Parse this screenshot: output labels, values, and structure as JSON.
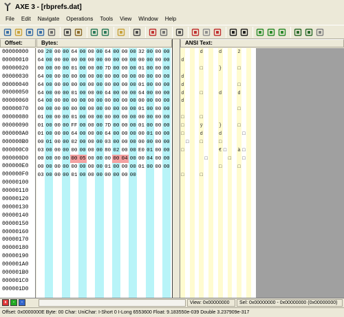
{
  "window": {
    "title": "AXE 3 - [rbprefs.dat]"
  },
  "menu": [
    "File",
    "Edit",
    "Navigate",
    "Operations",
    "Tools",
    "View",
    "Window",
    "Help"
  ],
  "toolbar": {
    "groups": [
      [
        "new-file-icon",
        "open-file-icon",
        "save-icon",
        "save-all-icon",
        "copy-icon"
      ],
      [
        "print-icon",
        "edit-icon"
      ],
      [
        "calculator-icon",
        "grid-icon"
      ],
      [
        "key-icon"
      ],
      [
        "goto-icon"
      ],
      [
        "bookmark-red-icon",
        "bookmark-gray-icon"
      ],
      [
        "split-icon"
      ],
      [
        "mark-red-icon",
        "mark-clear-icon",
        "mark-red2-icon"
      ],
      [
        "prev-icon",
        "next-icon"
      ],
      [
        "expand-icon",
        "collapse-icon",
        "zoom-icon"
      ],
      [
        "undo-icon",
        "redo-icon",
        "back-icon"
      ]
    ]
  },
  "headers": {
    "offset": "Offset:",
    "bytes": "Bytes:",
    "ansi": "ANSI Text:"
  },
  "offsets": [
    "00000000",
    "00000010",
    "00000020",
    "00000030",
    "00000040",
    "00000050",
    "00000060",
    "00000070",
    "00000080",
    "00000090",
    "000000A0",
    "000000B0",
    "000000C0",
    "000000D0",
    "000000E0",
    "000000F0",
    "00000100",
    "00000110",
    "00000120",
    "00000130",
    "00000140",
    "00000150",
    "00000160",
    "00000170",
    "00000180",
    "00000190",
    "000001A0",
    "000001B0",
    "000001C0",
    "000001D0"
  ],
  "bytes": [
    [
      "00",
      "20",
      "00",
      "00",
      "64",
      "00",
      "00",
      "00",
      "64",
      "00",
      "00",
      "00",
      "32",
      "00",
      "00",
      "00"
    ],
    [
      "64",
      "00",
      "00",
      "00",
      "00",
      "00",
      "00",
      "00",
      "00",
      "00",
      "00",
      "00",
      "00",
      "00",
      "00",
      "00"
    ],
    [
      "00",
      "00",
      "00",
      "00",
      "01",
      "00",
      "00",
      "00",
      "7D",
      "00",
      "00",
      "00",
      "01",
      "00",
      "00",
      "00"
    ],
    [
      "64",
      "00",
      "00",
      "00",
      "00",
      "00",
      "00",
      "00",
      "00",
      "00",
      "00",
      "00",
      "00",
      "00",
      "00",
      "00"
    ],
    [
      "64",
      "00",
      "00",
      "00",
      "00",
      "00",
      "00",
      "00",
      "00",
      "00",
      "00",
      "00",
      "01",
      "00",
      "00",
      "00"
    ],
    [
      "64",
      "00",
      "00",
      "00",
      "01",
      "00",
      "00",
      "00",
      "64",
      "00",
      "00",
      "00",
      "64",
      "00",
      "00",
      "00"
    ],
    [
      "64",
      "00",
      "00",
      "00",
      "00",
      "00",
      "00",
      "00",
      "00",
      "00",
      "00",
      "00",
      "00",
      "00",
      "00",
      "00"
    ],
    [
      "00",
      "00",
      "00",
      "00",
      "00",
      "00",
      "00",
      "00",
      "00",
      "00",
      "00",
      "00",
      "01",
      "00",
      "00",
      "00"
    ],
    [
      "01",
      "00",
      "00",
      "00",
      "01",
      "00",
      "00",
      "00",
      "00",
      "00",
      "00",
      "00",
      "00",
      "00",
      "00",
      "00"
    ],
    [
      "01",
      "00",
      "00",
      "00",
      "FF",
      "00",
      "00",
      "00",
      "7D",
      "00",
      "00",
      "00",
      "01",
      "00",
      "00",
      "00"
    ],
    [
      "01",
      "00",
      "00",
      "00",
      "64",
      "00",
      "00",
      "00",
      "64",
      "00",
      "00",
      "00",
      "00",
      "01",
      "00",
      "00"
    ],
    [
      "00",
      "01",
      "00",
      "00",
      "02",
      "00",
      "00",
      "00",
      "03",
      "00",
      "00",
      "00",
      "00",
      "00",
      "00",
      "00"
    ],
    [
      "03",
      "00",
      "00",
      "00",
      "00",
      "00",
      "00",
      "00",
      "80",
      "02",
      "00",
      "00",
      "E0",
      "01",
      "00",
      "00"
    ],
    [
      "00",
      "00",
      "00",
      "00",
      "00",
      "05",
      "00",
      "00",
      "00",
      "00",
      "04",
      "00",
      "00",
      "04",
      "00",
      "00"
    ],
    [
      "00",
      "00",
      "00",
      "00",
      "00",
      "00",
      "00",
      "00",
      "01",
      "00",
      "00",
      "00",
      "01",
      "00",
      "00",
      "00"
    ],
    [
      "03",
      "00",
      "00",
      "00",
      "01",
      "00",
      "00",
      "00",
      "00",
      "00",
      "00",
      "00"
    ]
  ],
  "highlight": [
    {
      "row": 13,
      "cols": [
        4,
        5,
        9,
        10
      ]
    }
  ],
  "ansi": [
    [
      "",
      "",
      "",
      "",
      "d",
      "",
      "",
      "",
      "d",
      "",
      "",
      "",
      "2",
      "",
      "",
      ""
    ],
    [
      "d",
      "",
      "",
      "",
      "",
      "",
      "",
      "",
      "",
      "",
      "",
      "",
      "",
      "",
      "",
      ""
    ],
    [
      "",
      "",
      "",
      "",
      "□",
      "",
      "",
      "",
      "}",
      "",
      "",
      "",
      "□",
      "",
      "",
      ""
    ],
    [
      "d",
      "",
      "",
      "",
      "",
      "",
      "",
      "",
      "",
      "",
      "",
      "",
      "",
      "",
      "",
      ""
    ],
    [
      "d",
      "",
      "",
      "",
      "",
      "",
      "",
      "",
      "",
      "",
      "",
      "",
      "□",
      "",
      "",
      ""
    ],
    [
      "d",
      "",
      "",
      "",
      "□",
      "",
      "",
      "",
      "d",
      "",
      "",
      "",
      "d",
      "",
      "",
      ""
    ],
    [
      "d",
      "",
      "",
      "",
      "",
      "",
      "",
      "",
      "",
      "",
      "",
      "",
      "",
      "",
      "",
      ""
    ],
    [
      "",
      "",
      "",
      "",
      "",
      "",
      "",
      "",
      "",
      "",
      "",
      "",
      "□",
      "",
      "",
      ""
    ],
    [
      "□",
      "",
      "",
      "",
      "□",
      "",
      "",
      "",
      "",
      "",
      "",
      "",
      "",
      "",
      "",
      ""
    ],
    [
      "□",
      "",
      "",
      "",
      "ÿ",
      "",
      "",
      "",
      "}",
      "",
      "",
      "",
      "□",
      "",
      "",
      ""
    ],
    [
      "□",
      "",
      "",
      "",
      "d",
      "",
      "",
      "",
      "d",
      "",
      "",
      "",
      "",
      "□",
      "",
      ""
    ],
    [
      "",
      "□",
      "",
      "",
      "□",
      "",
      "",
      "",
      "□",
      "",
      "",
      "",
      "",
      "",
      "",
      ""
    ],
    [
      "□",
      "",
      "",
      "",
      "",
      "",
      "",
      "",
      "€",
      "□",
      "",
      "",
      "à",
      "□",
      "",
      ""
    ],
    [
      "",
      "",
      "",
      "",
      "",
      "□",
      "",
      "",
      "",
      "",
      "□",
      "",
      "",
      "□",
      "",
      ""
    ],
    [
      "",
      "",
      "",
      "",
      "",
      "",
      "",
      "",
      "□",
      "",
      "",
      "",
      "□",
      "",
      "",
      ""
    ],
    [
      "□",
      "",
      "",
      "",
      "□",
      "",
      "",
      "",
      "",
      "",
      "",
      "",
      "",
      "",
      "",
      ""
    ]
  ],
  "status": {
    "view": "View: 0x00000000",
    "sel": "Sel: 0x00000000 - 0x00000000 (0x00000000)",
    "bar": "Offset: 0x0000000E Byte: 00  Char:   UniChar:    I-Short 0  I-Long 6553600  Float: 9.183550e-039 Double 3.237909e-317"
  },
  "colors": {
    "stripe_cyan": "#b8f4f8",
    "stripe_yellow": "#fffbd0",
    "highlight": "#f4a2a2"
  }
}
